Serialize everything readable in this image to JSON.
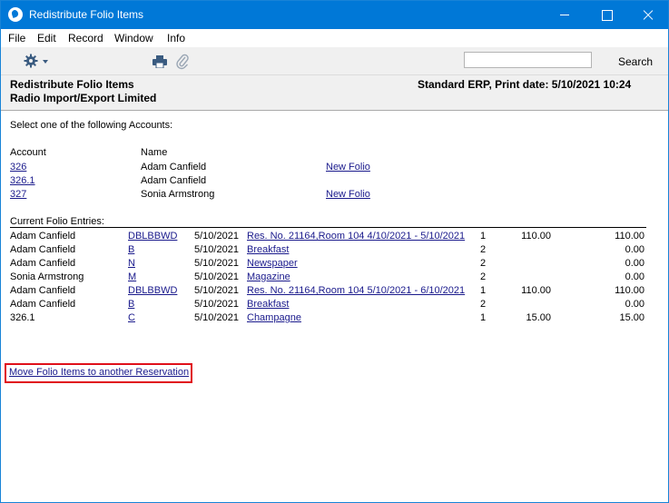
{
  "window": {
    "title": "Redistribute Folio Items"
  },
  "menu": [
    "File",
    "Edit",
    "Record",
    "Window",
    "Info"
  ],
  "toolbar": {
    "search_label": "Search",
    "search_value": ""
  },
  "header": {
    "title": "Redistribute Folio Items",
    "company": "Radio Import/Export Limited",
    "print_info": "Standard ERP, Print date: 5/10/2021 10:24"
  },
  "accounts": {
    "prompt": "Select one of the following Accounts:",
    "col_account": "Account",
    "col_name": "Name",
    "rows": [
      {
        "account": "326",
        "name": "Adam Canfield",
        "action": "New Folio"
      },
      {
        "account": "326.1",
        "name": "Adam Canfield",
        "action": ""
      },
      {
        "account": "327",
        "name": "Sonia Armstrong",
        "action": "New Folio"
      }
    ]
  },
  "entries": {
    "heading": "Current Folio Entries:",
    "rows": [
      {
        "name": "Adam Canfield",
        "code": "DBLBBWD",
        "date": "5/10/2021",
        "desc": "Res. No. 21164,Room 104 4/10/2021 - 5/10/2021",
        "qty": "1",
        "price": "110.00",
        "total": "110.00"
      },
      {
        "name": "Adam Canfield",
        "code": "B",
        "date": "5/10/2021",
        "desc": "Breakfast",
        "qty": "2",
        "price": "",
        "total": "0.00"
      },
      {
        "name": "Adam Canfield",
        "code": "N",
        "date": "5/10/2021",
        "desc": "Newspaper",
        "qty": "2",
        "price": "",
        "total": "0.00"
      },
      {
        "name": "Sonia Armstrong",
        "code": "M",
        "date": "5/10/2021",
        "desc": "Magazine",
        "qty": "2",
        "price": "",
        "total": "0.00"
      },
      {
        "name": "Adam Canfield",
        "code": "DBLBBWD",
        "date": "5/10/2021",
        "desc": "Res. No. 21164,Room 104 5/10/2021 - 6/10/2021",
        "qty": "1",
        "price": "110.00",
        "total": "110.00"
      },
      {
        "name": "Adam Canfield",
        "code": "B",
        "date": "5/10/2021",
        "desc": "Breakfast",
        "qty": "2",
        "price": "",
        "total": "0.00"
      },
      {
        "name": "326.1",
        "code": "C",
        "date": "5/10/2021",
        "desc": "Champagne",
        "qty": "1",
        "price": "15.00",
        "total": "15.00"
      }
    ]
  },
  "move_link": "Move Folio Items to another Reservation",
  "colors": {
    "titlebar": "#0078d7",
    "highlight": "#e0101a",
    "link": "#1a1a8c"
  }
}
